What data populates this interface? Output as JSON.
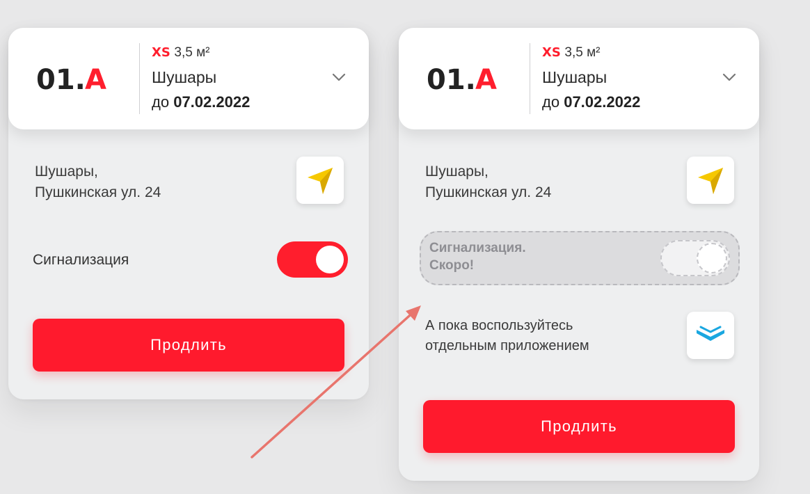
{
  "cards": [
    {
      "logo": {
        "text": "01.A"
      },
      "plan": {
        "size_tag": "XS",
        "area": "3,5 м²"
      },
      "location": "Шушары",
      "date_prefix": "до",
      "date": "07.02.2022",
      "address_line1": "Шушары,",
      "address_line2": "Пушкинская ул. 24",
      "alarm_label": "Сигнализация",
      "alarm_enabled": true,
      "extend_label": "Продлить"
    },
    {
      "logo": {
        "text": "01.A"
      },
      "plan": {
        "size_tag": "XS",
        "area": "3,5 м²"
      },
      "location": "Шушары",
      "date_prefix": "до",
      "date": "07.02.2022",
      "address_line1": "Шушары,",
      "address_line2": "Пушкинская ул. 24",
      "alarm_soon_line1": "Сигнализация.",
      "alarm_soon_line2": "Скоро!",
      "tip_line1": "А пока воспользуйтесь",
      "tip_line2": "отдельным приложением",
      "extend_label": "Продлить"
    }
  ],
  "colors": {
    "accent": "#ff1a2d",
    "nav_icon": "#f6c800",
    "app_icon": "#1aa7e0"
  },
  "icons": [
    "navigation-arrow-icon",
    "chevron-down-icon",
    "app-logo-icon"
  ]
}
